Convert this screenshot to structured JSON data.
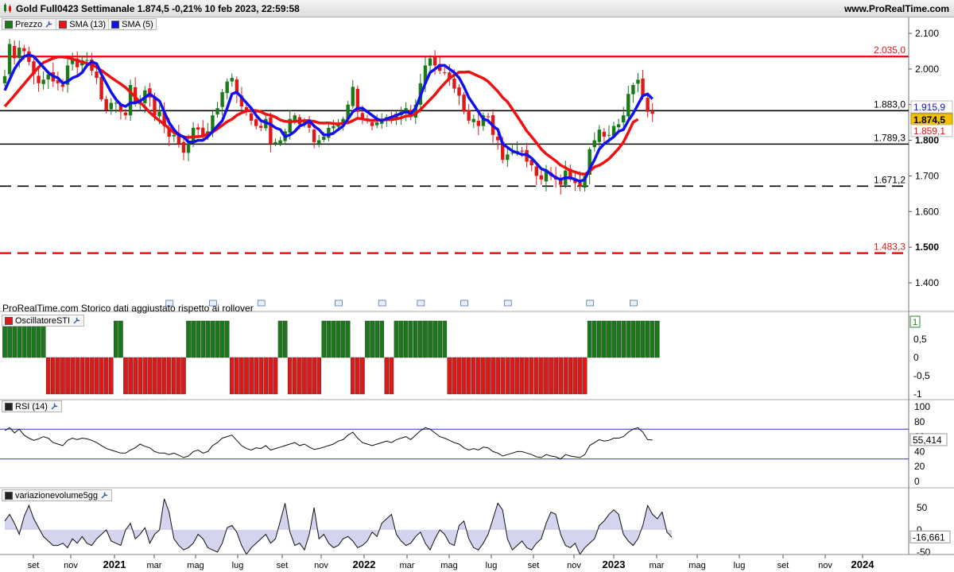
{
  "header": {
    "title": "Gold Full0423 Settimanale 1.874,5 -0,21% 10 feb 2023, 22:59:58",
    "site": "www.ProRealTime.com"
  },
  "legends": {
    "price": [
      "Prezzo",
      "SMA (13)",
      "SMA (5)"
    ],
    "oscillator": "OscillatoreSTI",
    "rsi": "RSI (14)",
    "volume": "variazionevolume5gg"
  },
  "footnote": "ProRealTime.com  Storico dati aggiustato rispetto ai rollover",
  "colors": {
    "up": "#1a7a1a",
    "down": "#e01818",
    "sma13": "#ee1111",
    "sma5": "#1111ee",
    "grid": "#000000",
    "badge_price": "#f2c200"
  },
  "chart_data": [
    {
      "type": "candlestick",
      "title": "Gold Full0423 Settimanale",
      "y_ticks": [
        "2.100",
        "2.000",
        "1.900",
        "1.800",
        "1.700",
        "1.600",
        "1.500",
        "1.400"
      ],
      "ylim": [
        1340,
        2140
      ],
      "levels": [
        {
          "value": 2035.0,
          "label": "2.035,0",
          "color": "#ee1111",
          "style": "solid"
        },
        {
          "value": 1883.0,
          "label": "1.883,0",
          "color": "#000000",
          "style": "solid"
        },
        {
          "value": 1789.3,
          "label": "1.789,3",
          "color": "#000000",
          "style": "solid"
        },
        {
          "value": 1671.2,
          "label": "1.671,2",
          "color": "#000000",
          "style": "dashed"
        },
        {
          "value": 1483.3,
          "label": "1.483,3",
          "color": "#ee1111",
          "style": "dashed"
        }
      ],
      "badges": [
        {
          "label": "1.915,9",
          "value": 1915.9,
          "kind": "sma5"
        },
        {
          "label": "1.874,5",
          "value": 1874.5,
          "kind": "price"
        },
        {
          "label": "1.859,1",
          "value": 1859.1,
          "kind": "sma13"
        }
      ],
      "series": [
        {
          "name": "Prezzo",
          "kind": "candles",
          "close": [
            1980,
            2070,
            2030,
            2060,
            2050,
            2020,
            1985,
            1960,
            1970,
            1985,
            1965,
            1960,
            1950,
            2010,
            2030,
            2005,
            2025,
            2025,
            1995,
            1975,
            1915,
            1885,
            1905,
            1905,
            1880,
            1870,
            1955,
            1905,
            1905,
            1940,
            1920,
            1870,
            1880,
            1840,
            1810,
            1815,
            1790,
            1765,
            1790,
            1835,
            1830,
            1810,
            1825,
            1870,
            1890,
            1935,
            1965,
            1975,
            1930,
            1895,
            1880,
            1855,
            1840,
            1835,
            1860,
            1790,
            1795,
            1800,
            1825,
            1860,
            1870,
            1845,
            1855,
            1835,
            1795,
            1800,
            1810,
            1835,
            1840,
            1850,
            1860,
            1900,
            1950,
            1880,
            1860,
            1855,
            1840,
            1850,
            1860,
            1865,
            1860,
            1875,
            1880,
            1890,
            1865,
            1900,
            1960,
            2010,
            2030,
            2010,
            1995,
            1990,
            1970,
            1945,
            1925,
            1880,
            1855,
            1860,
            1840,
            1870,
            1865,
            1815,
            1800,
            1745,
            1760,
            1765,
            1770,
            1770,
            1740,
            1730,
            1700,
            1690,
            1715,
            1700,
            1690,
            1675,
            1715,
            1690,
            1680,
            1670,
            1700,
            1775,
            1800,
            1830,
            1810,
            1815,
            1840,
            1845,
            1870,
            1930,
            1955,
            1970,
            1925,
            1880,
            1874.5
          ]
        },
        {
          "name": "SMA (13)",
          "kind": "line",
          "values": [
            1895,
            1910,
            1926,
            1942,
            1958,
            1974,
            1990,
            2005,
            2018,
            2024,
            2030,
            2034,
            2034,
            2032,
            2028,
            2024,
            2020,
            2016,
            2012,
            2005,
            1996,
            1986,
            1976,
            1967,
            1958,
            1948,
            1935,
            1921,
            1907,
            1893,
            1878,
            1866,
            1855,
            1845,
            1833,
            1822,
            1815,
            1809,
            1808,
            1810,
            1810,
            1812,
            1817,
            1823,
            1832,
            1842,
            1852,
            1859,
            1870,
            1877,
            1882,
            1884,
            1883,
            1880,
            1873,
            1870,
            1865,
            1857,
            1853,
            1852,
            1853,
            1854,
            1855,
            1855,
            1853,
            1849,
            1848,
            1849,
            1847,
            1845,
            1848,
            1849,
            1855,
            1862,
            1860,
            1857,
            1856,
            1856,
            1857,
            1858,
            1858,
            1860,
            1863,
            1868,
            1869,
            1875,
            1886,
            1900,
            1914,
            1928,
            1945,
            1960,
            1974,
            1983,
            1991,
            1991,
            1992,
            1986,
            1980,
            1974,
            1965,
            1951,
            1937,
            1920,
            1908,
            1888,
            1868,
            1847,
            1826,
            1810,
            1793,
            1775,
            1762,
            1752,
            1742,
            1730,
            1723,
            1715,
            1711,
            1706,
            1705,
            1713,
            1725,
            1730,
            1738,
            1748,
            1762,
            1777,
            1795,
            1822,
            1851,
            1859
          ]
        },
        {
          "name": "SMA (5)",
          "kind": "line",
          "values": [
            1940,
            1970,
            2000,
            2020,
            2035,
            2040,
            2035,
            2020,
            2005,
            1990,
            1980,
            1975,
            1960,
            1965,
            1975,
            1980,
            1990,
            2010,
            2020,
            2015,
            1985,
            1960,
            1935,
            1915,
            1900,
            1895,
            1905,
            1905,
            1910,
            1920,
            1930,
            1920,
            1910,
            1880,
            1850,
            1830,
            1815,
            1810,
            1795,
            1795,
            1800,
            1800,
            1810,
            1825,
            1840,
            1855,
            1890,
            1930,
            1935,
            1920,
            1905,
            1890,
            1870,
            1855,
            1850,
            1845,
            1835,
            1830,
            1810,
            1815,
            1825,
            1840,
            1845,
            1855,
            1840,
            1830,
            1815,
            1815,
            1820,
            1830,
            1840,
            1860,
            1880,
            1890,
            1890,
            1880,
            1870,
            1860,
            1855,
            1860,
            1865,
            1870,
            1875,
            1880,
            1875,
            1890,
            1925,
            1960,
            1990,
            2000,
            2010,
            2010,
            2000,
            1990,
            1975,
            1950,
            1920,
            1900,
            1880,
            1860,
            1855,
            1840,
            1830,
            1790,
            1780,
            1770,
            1765,
            1760,
            1760,
            1750,
            1735,
            1720,
            1715,
            1705,
            1695,
            1690,
            1695,
            1695,
            1690,
            1685,
            1690,
            1720,
            1745,
            1775,
            1790,
            1800,
            1810,
            1825,
            1830,
            1855,
            1875,
            1900,
            1925,
            1930,
            1916
          ]
        }
      ]
    },
    {
      "type": "bar",
      "title": "OscillatoreSTI",
      "y_ticks": [
        "1",
        "0,5",
        "0",
        "-0,5",
        "-1"
      ],
      "ylim": [
        -1.1,
        1.1
      ],
      "last_value_label": "1",
      "values": [
        1,
        1,
        1,
        1,
        1,
        1,
        1,
        1,
        1,
        -1,
        -1,
        -1,
        -1,
        -1,
        -1,
        -1,
        -1,
        -1,
        -1,
        -1,
        -1,
        -1,
        -1,
        1,
        1,
        -1,
        -1,
        -1,
        -1,
        -1,
        -1,
        -1,
        -1,
        -1,
        -1,
        -1,
        -1,
        -1,
        1,
        1,
        1,
        1,
        1,
        1,
        1,
        1,
        1,
        -1,
        -1,
        -1,
        -1,
        -1,
        -1,
        -1,
        -1,
        -1,
        -1,
        1,
        1,
        -1,
        -1,
        -1,
        -1,
        -1,
        -1,
        -1,
        1,
        1,
        1,
        1,
        1,
        1,
        -1,
        -1,
        -1,
        1,
        1,
        1,
        1,
        -1,
        -1,
        1,
        1,
        1,
        1,
        1,
        1,
        1,
        1,
        1,
        1,
        1,
        -1,
        -1,
        -1,
        -1,
        -1,
        -1,
        -1,
        -1,
        -1,
        -1,
        -1,
        -1,
        -1,
        -1,
        -1,
        -1,
        -1,
        -1,
        -1,
        -1,
        -1,
        -1,
        -1,
        -1,
        -1,
        -1,
        -1,
        -1,
        -1,
        1,
        1,
        1,
        1,
        1,
        1,
        1,
        1,
        1,
        1,
        1,
        1,
        1,
        1,
        1
      ]
    },
    {
      "type": "line",
      "title": "RSI (14)",
      "y_ticks": [
        "100",
        "80",
        "60",
        "40",
        "20",
        "0"
      ],
      "ylim": [
        0,
        100
      ],
      "bands": [
        70,
        30
      ],
      "last_value_label": "55,414",
      "values": [
        68,
        72,
        65,
        70,
        62,
        58,
        55,
        57,
        60,
        58,
        52,
        50,
        48,
        55,
        58,
        56,
        58,
        57,
        55,
        52,
        48,
        44,
        42,
        40,
        38,
        38,
        42,
        45,
        50,
        47,
        45,
        40,
        38,
        38,
        36,
        38,
        35,
        32,
        34,
        40,
        42,
        38,
        40,
        48,
        52,
        58,
        60,
        62,
        55,
        48,
        44,
        42,
        45,
        44,
        48,
        42,
        44,
        46,
        48,
        50,
        52,
        48,
        50,
        46,
        43,
        44,
        46,
        48,
        50,
        54,
        56,
        62,
        66,
        58,
        52,
        50,
        48,
        50,
        52,
        54,
        52,
        56,
        58,
        60,
        56,
        62,
        68,
        72,
        70,
        65,
        60,
        58,
        55,
        52,
        50,
        45,
        42,
        44,
        42,
        46,
        45,
        40,
        38,
        34,
        36,
        38,
        40,
        40,
        38,
        36,
        33,
        32,
        36,
        34,
        33,
        30,
        36,
        34,
        33,
        32,
        36,
        48,
        52,
        56,
        54,
        55,
        58,
        58,
        60,
        66,
        70,
        72,
        66,
        56,
        55.4
      ]
    },
    {
      "type": "area",
      "title": "variazionevolume5gg",
      "y_ticks": [
        "50",
        "0",
        "-50"
      ],
      "ylim": [
        -80,
        80
      ],
      "last_value_label": "-16,661",
      "values": [
        20,
        35,
        15,
        -10,
        30,
        55,
        25,
        5,
        -15,
        -25,
        -35,
        -35,
        -30,
        -40,
        -20,
        -30,
        -15,
        -30,
        -35,
        -20,
        -10,
        0,
        -25,
        -30,
        -35,
        0,
        15,
        -20,
        -10,
        5,
        -30,
        -10,
        0,
        70,
        40,
        -20,
        -35,
        -45,
        -40,
        -30,
        -10,
        -20,
        -40,
        -45,
        -50,
        -30,
        5,
        10,
        -5,
        -35,
        -55,
        -40,
        -30,
        -20,
        -10,
        -30,
        -20,
        20,
        60,
        -5,
        -35,
        -30,
        -45,
        -10,
        50,
        -20,
        -10,
        -30,
        -40,
        -35,
        -20,
        -15,
        -25,
        -40,
        -35,
        -25,
        -5,
        -15,
        15,
        25,
        35,
        -10,
        -25,
        -35,
        -30,
        -15,
        -5,
        -30,
        -45,
        -20,
        0,
        -10,
        -30,
        -35,
        10,
        20,
        -20,
        -40,
        -45,
        -30,
        -10,
        25,
        60,
        45,
        -20,
        -45,
        -35,
        -25,
        -40,
        -45,
        -30,
        -20,
        15,
        40,
        35,
        -10,
        -35,
        -40,
        -30,
        -55,
        -40,
        -30,
        -20,
        10,
        20,
        35,
        45,
        35,
        -10,
        -25,
        -35,
        -20,
        10,
        55,
        35,
        25,
        40,
        -5,
        -16.661
      ]
    }
  ],
  "x_axis": {
    "labels": [
      "set",
      "nov",
      "2021",
      "mar",
      "mag",
      "lug",
      "set",
      "nov",
      "2022",
      "mar",
      "mag",
      "lug",
      "set",
      "nov",
      "2023",
      "mar",
      "mag",
      "lug",
      "set",
      "nov",
      "2024"
    ],
    "bold": [
      "2021",
      "2022",
      "2023",
      "2024"
    ]
  }
}
